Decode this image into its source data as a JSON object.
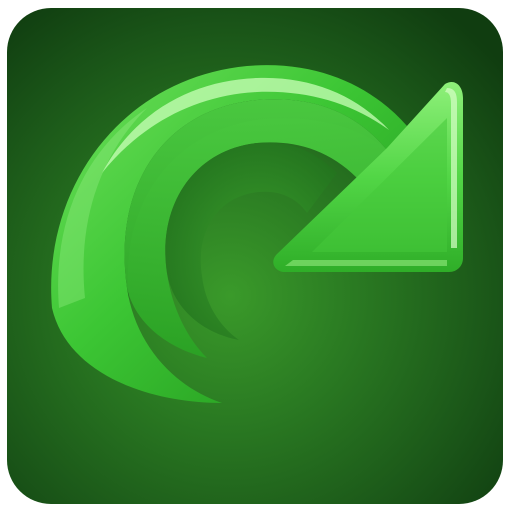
{
  "app_icon": {
    "name": "refresh-arrow",
    "icon": "redo-arrow-icon",
    "colors": {
      "background_dark": "#103d10",
      "background_mid": "#1b5a1a",
      "background_glow": "#2e8c24",
      "arrow_dark": "#1f9a1a",
      "arrow_mid": "#3cc634",
      "arrow_light": "#7fe56e",
      "highlight": "#c9ffb8"
    }
  }
}
